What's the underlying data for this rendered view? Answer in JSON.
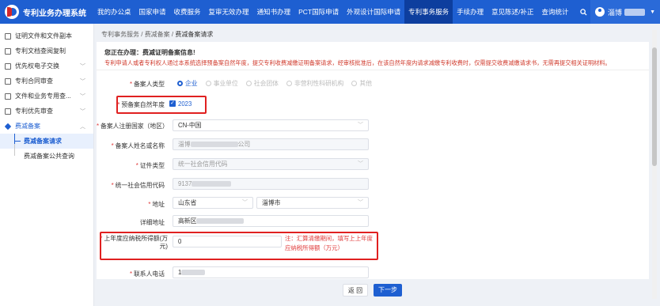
{
  "header": {
    "app_title": "专利业务办理系统",
    "nav": [
      "我的办公桌",
      "国家申请",
      "收费服务",
      "复审无效办理",
      "通知书办理",
      "PCT国际申请",
      "外观设计国际申请",
      "专利事务服务",
      "手续办理",
      "意见陈述/补正",
      "查询统计"
    ],
    "active_nav": "专利事务服务",
    "user_name": "淄博"
  },
  "sidebar": {
    "items": [
      {
        "label": "证明文件和文件副本"
      },
      {
        "label": "专利文档查阅复制"
      },
      {
        "label": "优先权电子交换"
      },
      {
        "label": "专利合同审查"
      },
      {
        "label": "文件和业务专用查..."
      },
      {
        "label": "专利优先审查"
      },
      {
        "label": "费减备案"
      }
    ],
    "subitems": [
      {
        "label": "费减备案请求"
      },
      {
        "label": "费减备案公共查询"
      }
    ]
  },
  "breadcrumb": {
    "items": [
      "专利事务服务",
      "费减备案",
      "费减备案请求"
    ]
  },
  "notice": {
    "title": "您正在办理：费减证明备案信息!",
    "text": "专利申请人或者专利权人通过本系统选择预备案自然年度，提交专利收费减缴证明备案请求，经审核批准后，在该自然年度内请求减缴专利收费时，仅需提交收费减缴请求书，无需再提交相关证明材料。"
  },
  "form": {
    "applicant_type": {
      "label": "备案人类型",
      "options": [
        "企业",
        "事业单位",
        "社会团体",
        "非营利性科研机构",
        "其他"
      ],
      "selected": "企业"
    },
    "year": {
      "label": "预备案自然年度",
      "value": "2023"
    },
    "country": {
      "label": "备案人注册国家（地区）",
      "value": "CN-中国"
    },
    "name": {
      "label": "备案人姓名或名称",
      "value_prefix": "淄博",
      "value_suffix": "公司"
    },
    "cert_type": {
      "label": "证件类型",
      "value": "统一社会信用代码"
    },
    "credit_code": {
      "label": "统一社会信用代码",
      "value_prefix": "9137"
    },
    "address": {
      "label": "地址",
      "province": "山东省",
      "city": "淄博市"
    },
    "detail_address": {
      "label": "详细地址",
      "value": "高新区"
    },
    "taxable_income": {
      "label": "上年度应纳税所得额(万元)",
      "value": "0",
      "note": "注：汇算清缴期间，填写上上年度应纳税所得额（万元）"
    },
    "contact_phone": {
      "label": "联系人电话",
      "value_prefix": "1"
    }
  },
  "buttons": {
    "back": "返 回",
    "next": "下一步"
  },
  "colors": {
    "primary": "#1e5fd1",
    "highlight": "#e02020",
    "notice_red": "#d03a2c"
  }
}
